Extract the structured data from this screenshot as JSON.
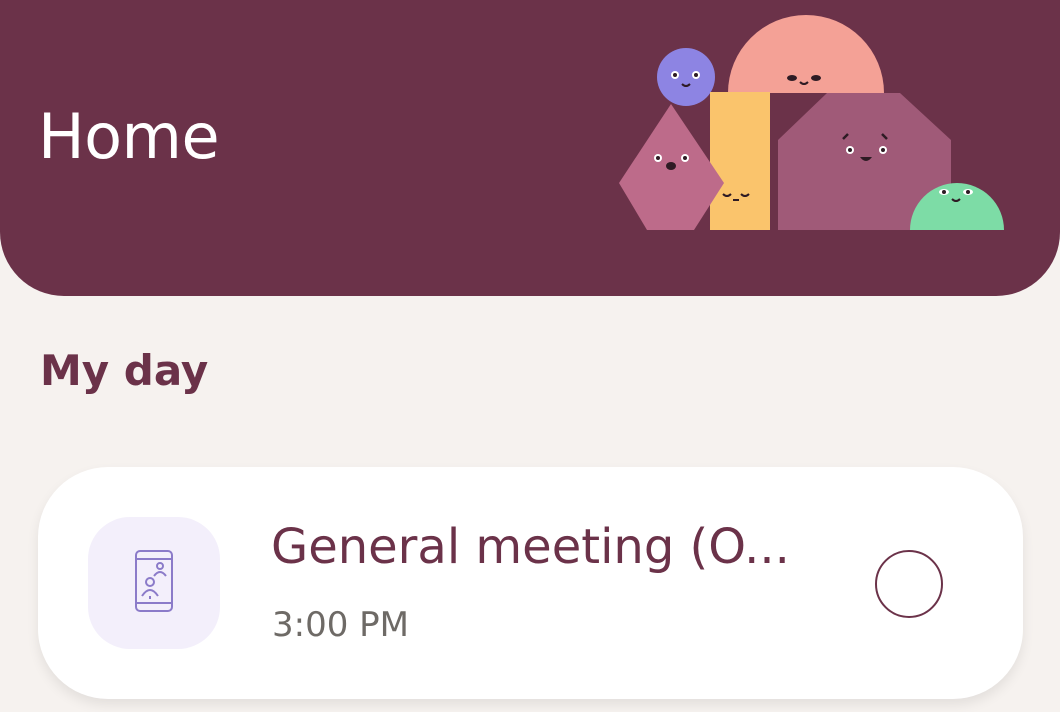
{
  "header": {
    "title": "Home"
  },
  "illustration": {
    "name": "smiling-shapes-illustration"
  },
  "section": {
    "title": "My day"
  },
  "task": {
    "title": "General meeting (O...",
    "time": "3:00 PM",
    "icon": "video-call-icon"
  },
  "colors": {
    "brand": "#6b3249",
    "background": "#f6f2ef",
    "card": "#ffffff",
    "icon_tile": "#f3effb",
    "icon_stroke": "#8b7bc9"
  }
}
